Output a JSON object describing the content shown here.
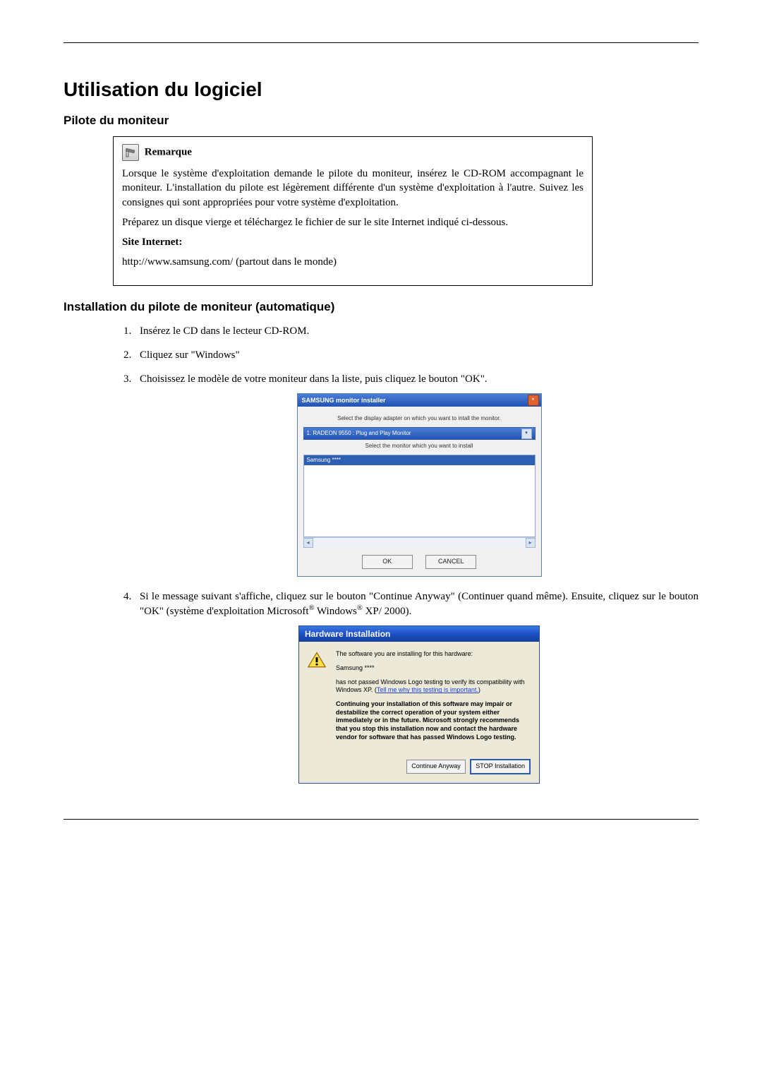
{
  "title": "Utilisation du logiciel",
  "section1_title": "Pilote du moniteur",
  "note": {
    "label": "Remarque",
    "p1": "Lorsque le système d'exploitation demande le pilote du moniteur, insérez le CD-ROM accompagnant le moniteur. L'installation du pilote est légèrement différente d'un système d'exploitation à l'autre. Suivez les consignes qui sont appropriées pour votre système d'exploitation.",
    "p2": "Préparez un disque vierge et téléchargez le fichier de sur le site Internet indiqué ci-dessous.",
    "site_label": "Site Internet:",
    "site_url": "http://www.samsung.com/ (partout dans le monde)"
  },
  "section2_title": "Installation du pilote de moniteur (automatique)",
  "steps": {
    "s1": "Insérez le CD dans le lecteur CD-ROM.",
    "s2": "Cliquez sur \"Windows\"",
    "s3": "Choisissez le modèle de votre moniteur dans la liste, puis cliquez le bouton \"OK\".",
    "s4_pre": "Si le message suivant s'affiche, cliquez sur le bouton \"Continue Anyway\" (Continuer quand même). Ensuite, cliquez sur le bouton \"OK\" (système d'exploitation Microsoft",
    "s4_mid": " Windows",
    "s4_post": " XP/ 2000)."
  },
  "installer": {
    "title": "SAMSUNG monitor installer",
    "instr1": "Select the display adapter on which you want to intall the monitor.",
    "adapter": "1. RADEON 9550 : Plug and Play Monitor",
    "instr2": "Select the monitor which you want to install",
    "selected": "Samsung ****",
    "ok": "OK",
    "cancel": "CANCEL"
  },
  "hw": {
    "title": "Hardware Installation",
    "p1": "The software you are installing for this hardware:",
    "name": "Samsung ****",
    "p2a": "has not passed Windows Logo testing to verify its compatibility with Windows XP. (",
    "link": "Tell me why this testing is important.",
    "p2b": ")",
    "bold": "Continuing your installation of this software may impair or destabilize the correct operation of your system either immediately or in the future. Microsoft strongly recommends that you stop this installation now and contact the hardware vendor for software that has passed Windows Logo testing.",
    "btn_continue": "Continue Anyway",
    "btn_stop": "STOP Installation"
  }
}
